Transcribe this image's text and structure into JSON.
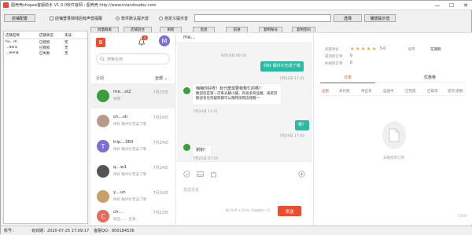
{
  "window": {
    "title": "图壳壳shopee客服助手 V1.0.0软件官网 : 图壳壳 http://www.miandoudou.com",
    "min": "—",
    "max": "☐",
    "close": "✕"
  },
  "toolbar": {
    "store_config": "店铺配置",
    "chk_sound": "店铺登录掉线后有声音提醒",
    "radio_default": "软件默认提示音",
    "radio_custom": "自定义提示音",
    "select_btn": "选择",
    "play_btn": "播放提示音"
  },
  "store_table": {
    "headers": [
      "店铺名称",
      "店铺状态",
      "未读"
    ],
    "rows": [
      {
        "name": "hu…m",
        "status": "已授权",
        "unread": "无"
      },
      {
        "name": "…dora",
        "status": "已授权",
        "unread": "无"
      },
      {
        "name": "…wang",
        "status": "已失败",
        "unread": "无"
      }
    ]
  },
  "small_buttons": [
    "批量群发",
    "店铺后台",
    "刷新",
    "后退",
    "前进",
    "复制账号",
    "复制密码"
  ],
  "chatapp": {
    "avatar_letter": "M",
    "bell_count": "3",
    "search_placeholder": "搜索名称",
    "recent_label": "近期",
    "all_label": "全部 ⌄",
    "conversations": [
      {
        "name": "me…ol2",
        "date": "7月25日",
        "msg": "谢谢",
        "color": "#3c9d3c",
        "letter": ""
      },
      {
        "name": "ch…sh",
        "date": "7月24日",
        "msg": "你好 靓衬衫无误了哦",
        "color": "#b79a88",
        "letter": ""
      },
      {
        "name": "trip…360",
        "date": "7月24日",
        "msg": "你好 靓衬衫无误了哦",
        "color": "#7b6fd6",
        "letter": "T"
      },
      {
        "name": "q…w1",
        "date": "7月24日",
        "msg": "你好 靓衬衫无误了哦",
        "color": "#555555",
        "letter": ""
      },
      {
        "name": "y…un",
        "date": "7月24日",
        "msg": "你好 靓衬衫无误了哦",
        "color": "#c9a06a",
        "letter": ""
      },
      {
        "name": "ch…",
        "date": "7月23日",
        "msg": "商品…… 台灣…",
        "color": "#e56b5b",
        "letter": "C"
      }
    ],
    "chat": {
      "header_name": "me…",
      "ts1": "6月18日 09:50",
      "out1": "你好 靓衬衫无误了哦",
      "ts2": "7月24日 17:41",
      "in1_l1": "嗨嗨你好呀！有什麼需要我幫忙的嗎？",
      "in1_l2": "歡迎您是第一次來光顧小鋪，有很多商品喔，再逛逛",
      "in1_l3": "歡迎有任何疑問都可以隨時詢問這裡喔～",
      "ts3": "7月24日 17:41",
      "out2": "嗯？",
      "ts4": "7月24日 17:42",
      "in2": "谢谢！",
      "ts5": "7月25日 07:59",
      "send_hint": "发送讯息",
      "enter_hint": "按 Shift + Enter 开始新的一行",
      "send": "发送"
    },
    "info": {
      "buyer_label": "买家评价",
      "rating": "5.0",
      "city_label": "城市",
      "city": "花蓮縣",
      "success_label": "成功的订单",
      "success": "0",
      "fail_label": "失败的订单",
      "fail": "0",
      "tab_orders": "订单",
      "tab_coupons": "优惠券",
      "subtabs": [
        "全部",
        "未付款",
        "待出货",
        "运送中",
        "已完成",
        "已取消",
        "退货/退款"
      ],
      "empty_text": "未能找到订单",
      "watermark": "Chat"
    }
  },
  "statusbar": {
    "account": "账号：",
    "expire": "有效期：2020-07-25 17:09:17",
    "qq": "客服QQ：800184536"
  }
}
